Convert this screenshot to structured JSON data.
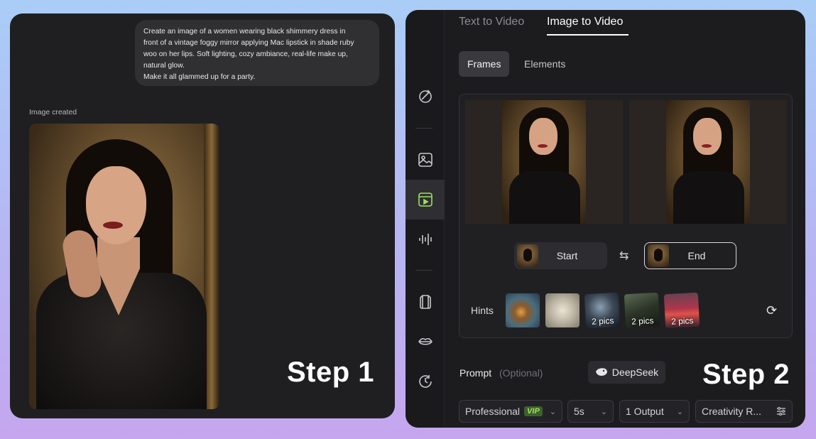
{
  "step1": {
    "prompt_lines": [
      "Create an image of a women wearing black shimmery dress in",
      "front of a vintage foggy mirror applying Mac lipstick in shade ruby",
      "woo on her lips. Soft lighting, cozy ambiance, real-life make up,",
      "natural glow.",
      "Make it all glammed up for a party."
    ],
    "status": "Image created",
    "step_label": "Step 1"
  },
  "step2": {
    "tabs": [
      "Text to Video",
      "Image to Video"
    ],
    "active_tab": "Image to Video",
    "subtabs": [
      "Frames",
      "Elements"
    ],
    "active_subtab": "Frames",
    "start_label": "Start",
    "end_label": "End",
    "hints_label": "Hints",
    "hints": [
      {
        "count": ""
      },
      {
        "count": ""
      },
      {
        "count": "2 pics"
      },
      {
        "count": "2 pics"
      },
      {
        "count": "2 pics"
      }
    ],
    "prompt_label": "Prompt",
    "prompt_optional": "(Optional)",
    "deepseek_label": "DeepSeek",
    "step_label": "Step 2",
    "controls": {
      "mode": "Professional",
      "mode_badge": "VIP",
      "duration": "5s",
      "outputs": "1 Output",
      "creativity": "Creativity R..."
    },
    "sidebar_icons": [
      "magic-edit-icon",
      "image-icon",
      "video-icon",
      "audio-wave-icon",
      "outfit-icon",
      "lips-icon",
      "history-icon"
    ],
    "accent_color": "#9be35a"
  }
}
